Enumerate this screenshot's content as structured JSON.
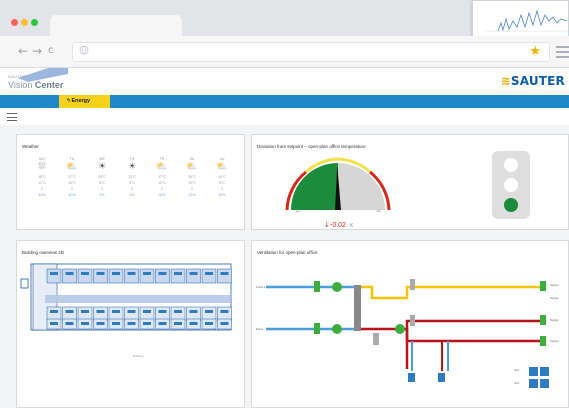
{
  "browser": {
    "window_controls": [
      "close",
      "minimize",
      "maximize"
    ],
    "back_icon": "back-arrow-icon",
    "forward_icon": "forward-arrow-icon",
    "reload_icon": "reload-icon",
    "url_icon": "globe-icon",
    "bookmark_icon": "star-icon",
    "menu_icon": "menu-icon"
  },
  "app": {
    "logo_small": "SAUTER",
    "product_name_light": "Vision ",
    "product_name_bold": "Center",
    "brand": "SAUTER",
    "nav_tab_energy": "Energy"
  },
  "weather": {
    "title": "Weather",
    "days": [
      {
        "day": "MO",
        "icon": "cloud-rain-icon",
        "temp": "18°C",
        "low": "11°C",
        "wind": "0",
        "rain": "40%"
      },
      {
        "day": "TU",
        "icon": "sun-cloud-icon",
        "temp": "17°C",
        "low": "10°C",
        "wind": "0",
        "rain": "40%"
      },
      {
        "day": "WE",
        "icon": "sun-icon",
        "temp": "20°C",
        "low": "8°C",
        "wind": "0",
        "rain": "5%"
      },
      {
        "day": "TH",
        "icon": "sun-icon",
        "temp": "22°C",
        "low": "9°C",
        "wind": "0",
        "rain": "0%"
      },
      {
        "day": "FR",
        "icon": "sun-cloud-icon",
        "temp": "17°C",
        "low": "10°C",
        "wind": "0",
        "rain": "30%"
      },
      {
        "day": "SA",
        "icon": "sun-cloud-icon",
        "temp": "18°C",
        "low": "10°C",
        "wind": "0",
        "rain": "20%"
      },
      {
        "day": "SU",
        "icon": "sun-cloud-icon",
        "temp": "14°C",
        "low": "9°C",
        "wind": "0",
        "rain": "40%"
      }
    ]
  },
  "deviation": {
    "title": "Deviation from setpoint – open-plan office temperature",
    "min": "-10",
    "max": "10",
    "value": "-0.02",
    "unit": "K",
    "gauge_fraction": 0.495,
    "colors": {
      "red": "#d7281c",
      "yellow": "#f2e14c",
      "green": "#1c8b3c",
      "grey": "#d6d6d6"
    },
    "traffic_light_active": "green"
  },
  "building": {
    "title": "Building overview 2D",
    "footer_label": "Building"
  },
  "ventilation": {
    "title": "Ventilation for open-plan office",
    "in_label_top": "Fresh ▸",
    "in_label_bottom": "Exh ▸",
    "out_labels": [
      "Supply",
      "Supply",
      "Supply",
      "Supply"
    ],
    "status_labels": [
      "Vent",
      "Vent"
    ]
  }
}
